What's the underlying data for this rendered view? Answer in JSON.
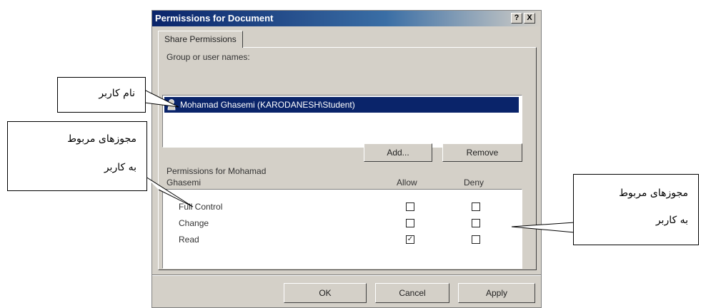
{
  "dialog": {
    "title": "Permissions for Document",
    "help_button": "?",
    "close_button": "X",
    "tab_label": "Share Permissions",
    "group_label": "Group or user names:",
    "users": [
      "Mohamad Ghasemi (KARODANESH\\Student)"
    ],
    "add_button": "Add...",
    "remove_button": "Remove",
    "permissions_label_line1": "Permissions for Mohamad",
    "permissions_label_line2": "Ghasemi",
    "allow_header": "Allow",
    "deny_header": "Deny",
    "permissions": [
      {
        "name": "Full Control",
        "allow": false,
        "deny": false
      },
      {
        "name": "Change",
        "allow": false,
        "deny": false
      },
      {
        "name": "Read",
        "allow": true,
        "deny": false
      }
    ],
    "ok_button": "OK",
    "cancel_button": "Cancel",
    "apply_button": "Apply"
  },
  "callouts": {
    "username": "نام کاربر",
    "user_permissions_left_line1": "مجوزهای مربوط",
    "user_permissions_left_line2": "به کاربر",
    "user_permissions_right_line1": "مجوزهای مربوط",
    "user_permissions_right_line2": "به کاربر"
  },
  "colors": {
    "titlebar": "#0a246a",
    "selection": "#0a246a",
    "dialog_face": "#d4d0c8"
  }
}
